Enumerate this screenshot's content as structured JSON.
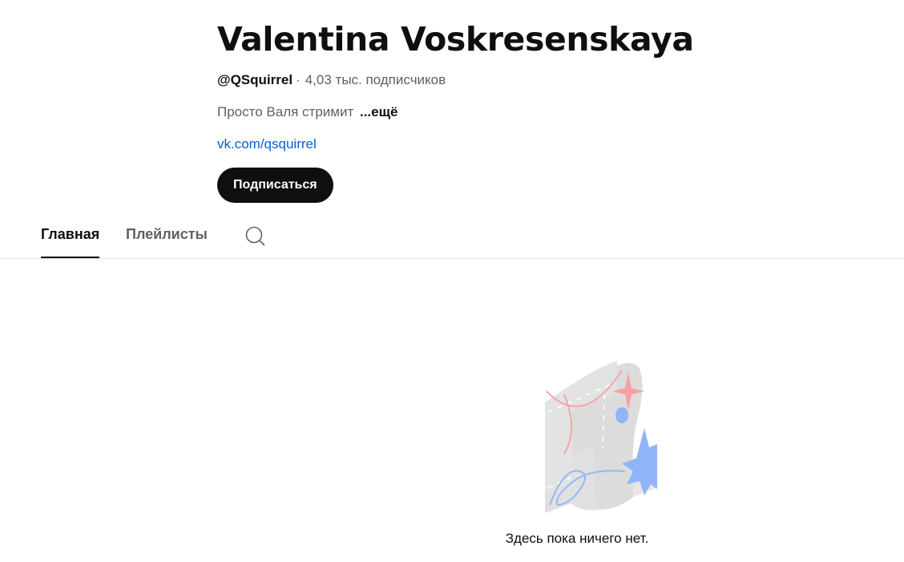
{
  "channel": {
    "name": "Valentina Voskresenskaya",
    "handle": "@QSquirrel",
    "separator": "·",
    "subscribers": "4,03 тыс. подписчиков",
    "description": "Просто Валя стримит",
    "more_label": "...ещё",
    "link": "vk.com/qsquirrel",
    "subscribe_label": "Подписаться"
  },
  "tabs": [
    {
      "label": "Главная",
      "selected": true
    },
    {
      "label": "Плейлисты",
      "selected": false
    }
  ],
  "icons": {
    "tab_search": "search-icon",
    "empty_state": "empty-state-illustration"
  },
  "empty_state": {
    "text": "Здесь пока ничего нет."
  },
  "colors": {
    "text_primary": "#0f0f0f",
    "text_secondary": "#606060",
    "link": "#065fd4",
    "button_bg": "#0f0f0f",
    "divider": "#e5e5e5"
  }
}
